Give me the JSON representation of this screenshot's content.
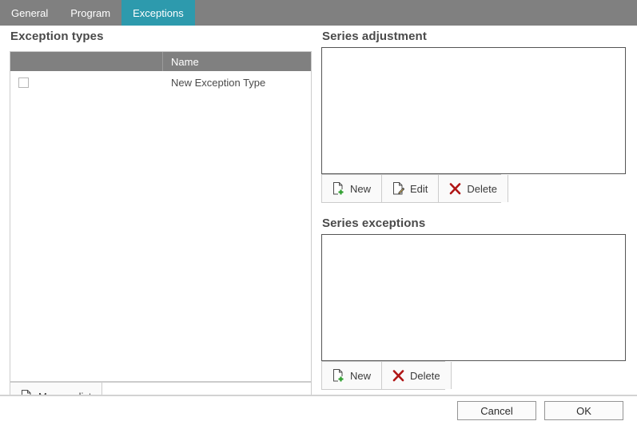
{
  "tabs": [
    {
      "label": "General",
      "active": false
    },
    {
      "label": "Program",
      "active": false
    },
    {
      "label": "Exceptions",
      "active": true
    }
  ],
  "left_panel": {
    "title": "Exception types",
    "columns": [
      "",
      "Name"
    ],
    "rows": [
      {
        "checked": false,
        "name": "New Exception Type"
      }
    ],
    "toolbar": {
      "manage_label": "Manage list",
      "manage_icon": "new-document-icon"
    }
  },
  "series_adjustment": {
    "title": "Series adjustment",
    "items": [],
    "toolbar": {
      "new_label": "New",
      "new_icon": "new-document-icon",
      "edit_label": "Edit",
      "edit_icon": "edit-document-icon",
      "delete_label": "Delete",
      "delete_icon": "delete-x-icon"
    }
  },
  "series_exceptions": {
    "title": "Series exceptions",
    "items": [],
    "toolbar": {
      "new_label": "New",
      "new_icon": "new-document-icon",
      "delete_label": "Delete",
      "delete_icon": "delete-x-icon"
    }
  },
  "dialog_buttons": {
    "cancel_label": "Cancel",
    "ok_label": "OK"
  },
  "colors": {
    "tabbar_bg": "#808080",
    "tab_active_bg": "#2d9aad",
    "grid_header_bg": "#808080",
    "icon_green": "#2f9e2f",
    "icon_red": "#b01515",
    "text": "#3b3b3b"
  }
}
